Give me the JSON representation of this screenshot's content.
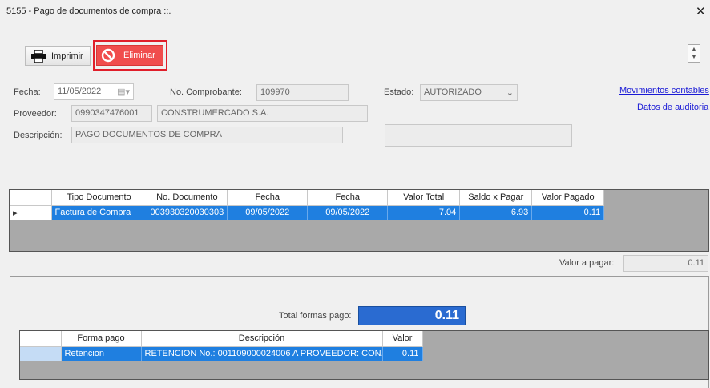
{
  "window": {
    "title": "5155 - Pago de documentos de compra ::.",
    "close_label": "✕"
  },
  "toolbar": {
    "print_label": "Imprimir",
    "delete_label": "Eliminar"
  },
  "form": {
    "fecha_label": "Fecha:",
    "fecha_value": "11/05/2022",
    "comprobante_label": "No. Comprobante:",
    "comprobante_value": "109970",
    "estado_label": "Estado:",
    "estado_value": "AUTORIZADO",
    "proveedor_label": "Proveedor:",
    "proveedor_ruc": "0990347476001",
    "proveedor_nombre": "CONSTRUMERCADO S.A.",
    "descripcion_label": "Descripción:",
    "descripcion_value": "PAGO DOCUMENTOS DE COMPRA"
  },
  "links": {
    "movimientos": "Movimientos contables",
    "auditoria": "Datos de auditoria"
  },
  "documents_grid": {
    "columns": [
      "Tipo Documento",
      "No. Documento",
      "Fecha",
      "Fecha",
      "Valor Total",
      "Saldo x Pagar",
      "Valor Pagado"
    ],
    "rows": [
      {
        "tipo": "Factura de Compra",
        "numero": "003930320030303",
        "fecha1": "09/05/2022",
        "fecha2": "09/05/2022",
        "total": "7.04",
        "saldo": "6.93",
        "pagado": "0.11"
      }
    ]
  },
  "valor_pagar": {
    "label": "Valor a pagar:",
    "value": "0.11"
  },
  "total_formas": {
    "label": "Total formas pago:",
    "value": "0.11"
  },
  "payment_grid": {
    "columns": [
      "Forma pago",
      "Descripción",
      "Valor"
    ],
    "rows": [
      {
        "forma": "Retencion",
        "descripcion": "RETENCION No.: 001109000024006 A PROVEEDOR: CON...",
        "valor": "0.11"
      }
    ]
  }
}
